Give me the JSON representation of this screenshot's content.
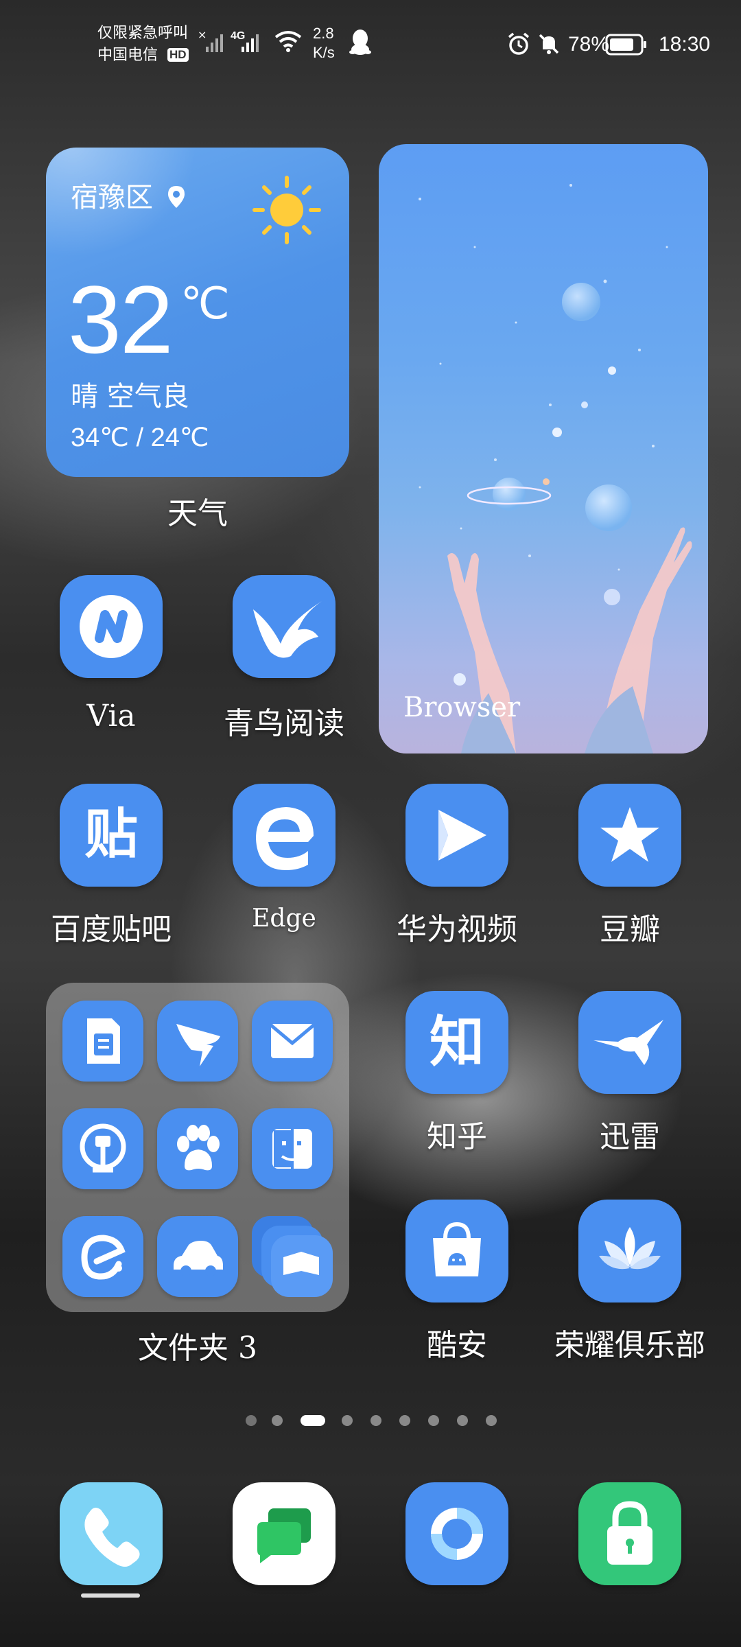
{
  "status_bar": {
    "carrier_line1": "仅限紧急呼叫",
    "carrier_line2": "中国电信",
    "hd_badge": "HD",
    "network_type": "4G",
    "speed_value": "2.8",
    "speed_unit": "K/s",
    "battery_percent": "78%",
    "time": "18:30",
    "icons": [
      "no-signal-icon",
      "signal-icon",
      "wifi-icon",
      "qq-icon",
      "alarm-icon",
      "mute-icon",
      "battery-icon"
    ]
  },
  "weather_widget": {
    "location": "宿豫区",
    "temperature": "32",
    "unit": "℃",
    "condition": "晴 空气良",
    "range": "34℃ / 24℃",
    "label": "天气",
    "icon": "sun-icon"
  },
  "browser_widget": {
    "label": "Browser"
  },
  "apps": [
    {
      "name": "Via",
      "icon": "via-icon"
    },
    {
      "name": "青鸟阅读",
      "icon": "bird-icon"
    },
    {
      "name": "百度贴吧",
      "icon": "tieba-icon",
      "glyph": "贴"
    },
    {
      "name": "Edge",
      "icon": "edge-icon"
    },
    {
      "name": "华为视频",
      "icon": "play-icon"
    },
    {
      "name": "豆瓣",
      "icon": "star-icon"
    },
    {
      "name": "知乎",
      "icon": "zhihu-icon",
      "glyph": "知"
    },
    {
      "name": "迅雷",
      "icon": "hummingbird-icon"
    },
    {
      "name": "酷安",
      "icon": "store-icon"
    },
    {
      "name": "荣耀俱乐部",
      "icon": "lotus-icon"
    }
  ],
  "folder": {
    "label": "文件夹 3",
    "icons": [
      "sim-card-icon",
      "dingtalk-icon",
      "mail-icon",
      "railway-icon",
      "paw-icon",
      "finder-icon",
      "eleme-icon",
      "car-icon",
      "stacked-books-icon"
    ]
  },
  "page_indicator": {
    "count": 9,
    "active_index": 2
  },
  "dock": {
    "icons": [
      "phone-icon",
      "messages-icon",
      "browser-ring-icon",
      "lock-icon"
    ],
    "colors": [
      "#7dd3f5",
      "#ffffff",
      "#4a8ff0",
      "#33c77a"
    ]
  },
  "colors": {
    "icon_blue": "#4a8ff0",
    "weather_blue": "#4f93e8"
  }
}
